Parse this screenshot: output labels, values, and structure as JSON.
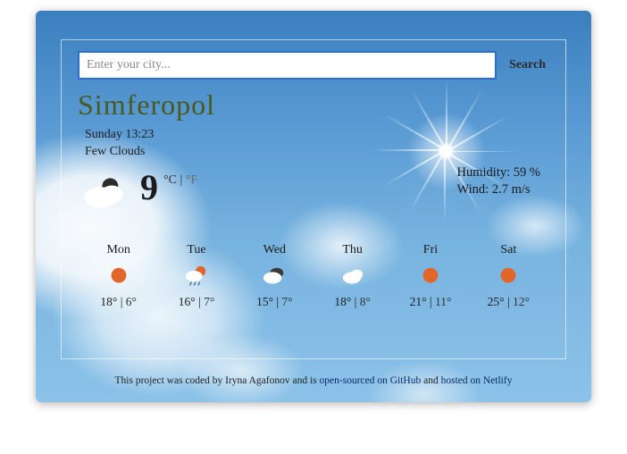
{
  "search": {
    "placeholder": "Enter your city...",
    "button": "Search"
  },
  "city": "Simferopol",
  "datetime": "Sunday 13:23",
  "description": "Few Clouds",
  "current": {
    "temp": "9",
    "unit_c": "°C",
    "unit_sep": " | ",
    "unit_f": "°F",
    "humidity_label": "Humidity: ",
    "humidity_value": "59 %",
    "wind_label": "Wind: ",
    "wind_value": "2.7 m/s",
    "icon": "few-clouds"
  },
  "forecast": [
    {
      "day": "Mon",
      "icon": "clear",
      "hi": "18°",
      "lo": "6°"
    },
    {
      "day": "Tue",
      "icon": "partly-rain",
      "hi": "16°",
      "lo": "7°"
    },
    {
      "day": "Wed",
      "icon": "cloudy-dark",
      "hi": "15°",
      "lo": "7°"
    },
    {
      "day": "Thu",
      "icon": "cloud",
      "hi": "18°",
      "lo": "8°"
    },
    {
      "day": "Fri",
      "icon": "clear",
      "hi": "21°",
      "lo": "11°"
    },
    {
      "day": "Sat",
      "icon": "clear",
      "hi": "25°",
      "lo": "12°"
    }
  ],
  "footer": {
    "prefix": "This project was coded by ",
    "author": "Iryna Agafonov",
    "mid1": " and is ",
    "link1": "open-sourced on GitHub",
    "mid2": " and ",
    "link2": "hosted on Netlify"
  }
}
